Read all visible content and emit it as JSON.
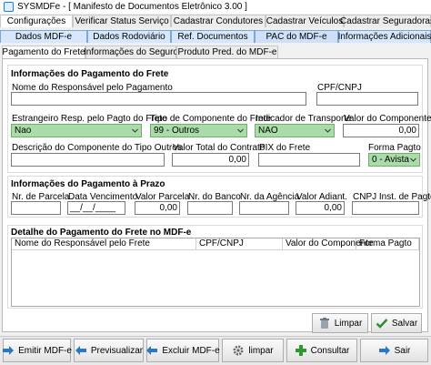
{
  "window": {
    "title": "SYSMDFe - [ Manifesto de Documentos Eletrônico 3.00 ]"
  },
  "menu_tabs": [
    "Configurações",
    "Verificar Status Serviço",
    "Cadastrar Condutores",
    "Cadastrar Veículos",
    "Cadastrar Seguradoras"
  ],
  "doc_tabs": [
    "Dados MDF-e",
    "Dados Rodoviário",
    "Ref. Documentos",
    "PAC do MDF-e",
    "Informações Adicionais"
  ],
  "doc_tabs_active": "PAC do MDF-e",
  "sub_tabs": [
    "Pagamento do Frete",
    "Informações do Seguro",
    "Produto Pred. do MDF-e"
  ],
  "sub_tabs_active": "Pagamento do Frete",
  "pagamento": {
    "section_title": "Informações do Pagamento do Frete",
    "responsavel_label": "Nome do Responsável pelo Pagamento",
    "responsavel_value": "",
    "cpf_label": "CPF/CNPJ",
    "cpf_value": "",
    "estrangeiro_label": "Estrangeiro Resp. pelo Pagto do Frete",
    "estrangeiro_value": "Nao",
    "tipo_label": "Tipo de Componente do Frete",
    "tipo_value": "99 - Outros",
    "indicador_label": "Indicador de Transporte",
    "indicador_value": "NAO",
    "valor_comp_label": "Valor do Componente",
    "valor_comp_value": "0,00",
    "descricao_label": "Descrição do Componente do Tipo Outros",
    "descricao_value": "",
    "valor_total_label": "Valor Total do Contrato",
    "valor_total_value": "0,00",
    "pix_label": "PIX do Frete",
    "pix_value": "",
    "forma_label": "Forma Pagto",
    "forma_value": "0 - Avista"
  },
  "prazo": {
    "section_title": "Informações do Pagamento à Prazo",
    "parcela_label": "Nr. de Parcela",
    "parcela_value": "",
    "vencimento_label": "Data Vencimento",
    "vencimento_value": "__/__/____",
    "valor_parcela_label": "Valor Parcela",
    "valor_parcela_value": "0,00",
    "banco_label": "Nr. do Banco",
    "banco_value": "",
    "agencia_label": "Nr. da Agência",
    "agencia_value": "",
    "adiant_label": "Valor Adiant.",
    "adiant_value": "0,00",
    "cnpj_inst_label": "CNPJ Inst. de Pagto",
    "cnpj_inst_value": ""
  },
  "detalhe": {
    "section_title": "Detalhe do Pagamento do Frete no MDF-e",
    "columns": [
      "Nome do Responsável pelo Frete",
      "CPF/CNPJ",
      "Valor do Componente",
      "Forma Pagto"
    ]
  },
  "actions": {
    "limpar": "Limpar",
    "salvar": "Salvar"
  },
  "footer": {
    "emitir": "Emitir MDF-e",
    "previsualizar": "Previsualizar",
    "excluir": "Excluir  MDF-e",
    "limpar": "limpar",
    "consultar": "Consultar",
    "sair": "Sair"
  },
  "colors": {
    "accent_tab": "#d6e7fb",
    "field_green": "#a9dca8",
    "border": "#7a7a7a"
  },
  "icons": [
    "app-icon",
    "dropdown-arrow-icon",
    "trash-icon",
    "check-icon",
    "arrow-right-icon",
    "arrow-left-icon",
    "gear-icon",
    "plus-icon",
    "exit-arrow-icon"
  ]
}
